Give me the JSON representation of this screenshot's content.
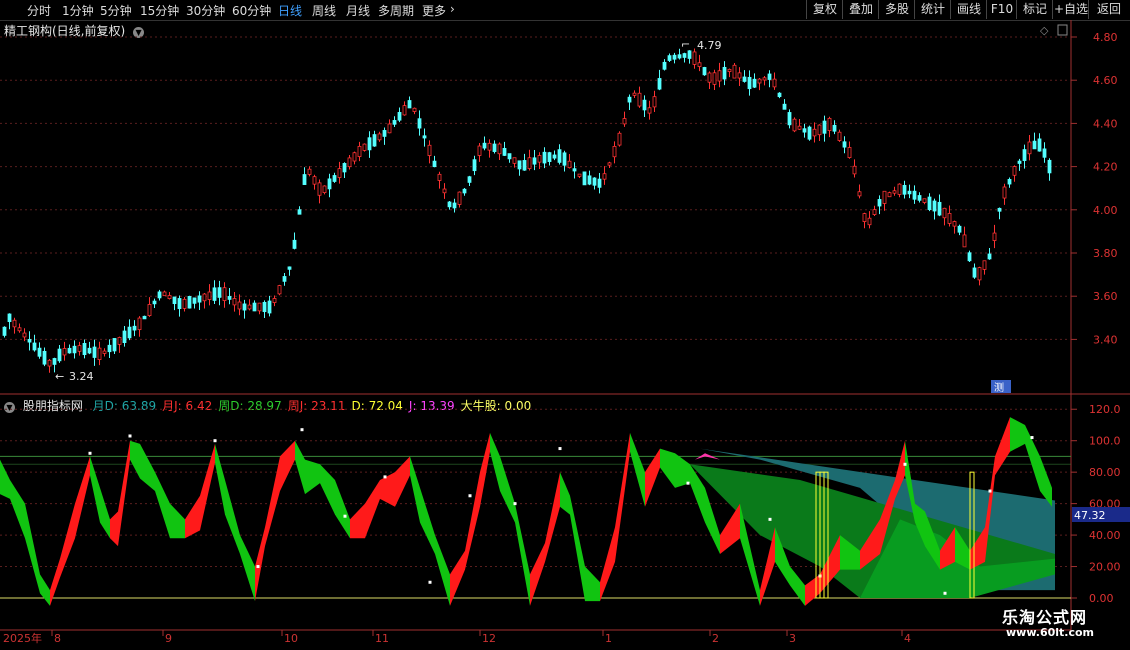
{
  "toolbar": {
    "periods": [
      "分时",
      "1分钟",
      "5分钟",
      "15分钟",
      "30分钟",
      "60分钟",
      "日线",
      "周线",
      "月线",
      "多周期",
      "更多"
    ],
    "active_period": "日线",
    "more_arrow": "›",
    "right_buttons": [
      "复权",
      "叠加",
      "多股",
      "统计",
      "画线",
      "F10",
      "标记",
      "+自选",
      "返回"
    ]
  },
  "price_chart": {
    "title": "精工钢构(日线,前复权)",
    "high_label": "4.79",
    "low_label": "3.24",
    "side_tag": "测",
    "y_ticks": [
      "4.80",
      "4.60",
      "4.40",
      "4.20",
      "4.00",
      "3.80",
      "3.60",
      "3.40"
    ],
    "up_color": "#ff3333",
    "down_color": "#54ffff"
  },
  "indicator": {
    "name": "股朋指标网",
    "items": [
      {
        "label": "月D: 63.89",
        "color": "#21a6a6"
      },
      {
        "label": "月J: 6.42",
        "color": "#ff3030"
      },
      {
        "label": "周D: 28.97",
        "color": "#2ecc2e"
      },
      {
        "label": "周J: 23.11",
        "color": "#ff3030"
      },
      {
        "label": "D: 72.04",
        "color": "#ffff33"
      },
      {
        "label": "J: 13.39",
        "color": "#ff44ff"
      },
      {
        "label": "大牛股: 0.00",
        "color": "#ffff66"
      }
    ],
    "y_ticks": [
      "120.0",
      "100.0",
      "80.00",
      "60.00",
      "40.00",
      "20.00",
      "0.00"
    ],
    "current_value": "47.32"
  },
  "time_axis": {
    "year_label": "2025年",
    "months": [
      "8",
      "9",
      "10",
      "11",
      "12",
      "1",
      "2",
      "3",
      "4"
    ]
  },
  "watermark": {
    "line1": "乐淘公式网",
    "line2": "www.60lt.com"
  }
}
